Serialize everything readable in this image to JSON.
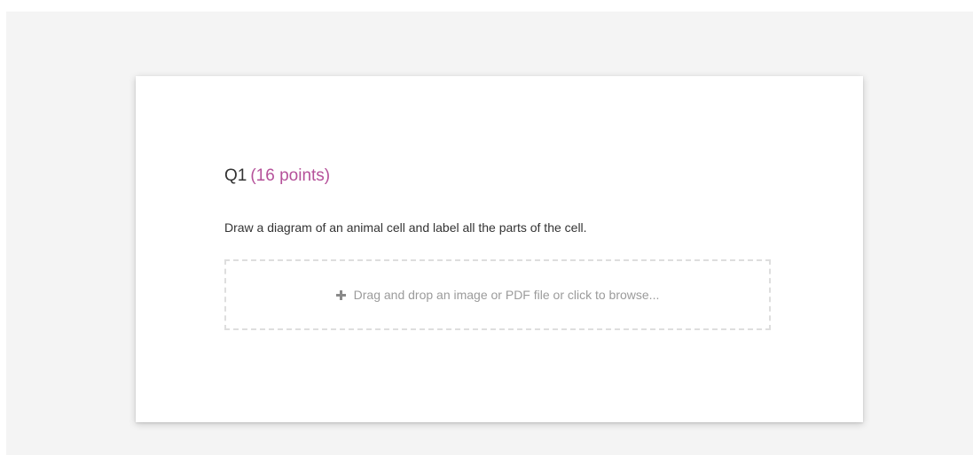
{
  "question": {
    "number_label": "Q1",
    "points_label": "(16 points)",
    "prompt": "Draw a diagram of an animal cell and label all the parts of the cell."
  },
  "upload": {
    "icon": "plus-icon",
    "label": "Drag and drop an image or PDF file or click to browse..."
  },
  "colors": {
    "accent": "#b5519a",
    "background": "#f4f4f4",
    "card": "#ffffff",
    "text": "#333333",
    "muted_text": "#9b9b9b",
    "dashed_border": "#dedede"
  }
}
